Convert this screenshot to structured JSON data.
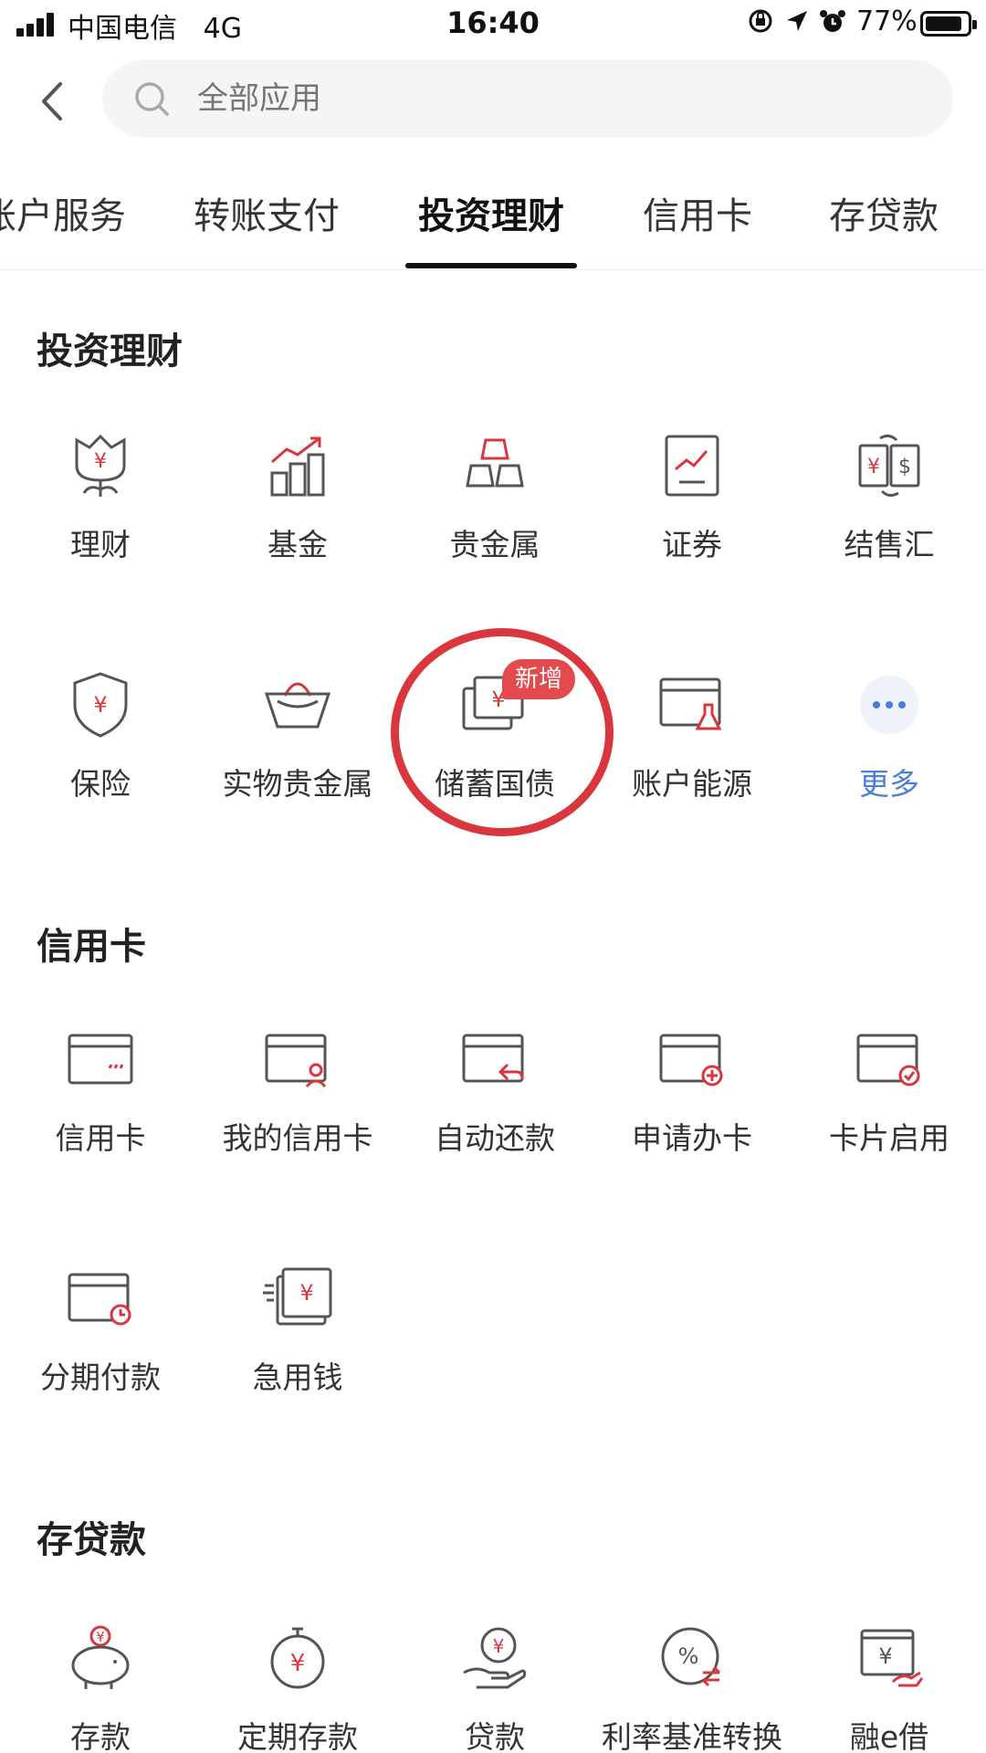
{
  "status_bar": {
    "carrier": "中国电信",
    "network": "4G",
    "time": "16:40",
    "battery": "77%"
  },
  "search": {
    "placeholder": "全部应用"
  },
  "tabs": [
    {
      "label": "账户服务",
      "active": false
    },
    {
      "label": "转账支付",
      "active": false
    },
    {
      "label": "投资理财",
      "active": true
    },
    {
      "label": "信用卡",
      "active": false
    },
    {
      "label": "存贷款",
      "active": false
    }
  ],
  "sections": [
    {
      "title": "投资理财",
      "items": [
        {
          "label": "理财",
          "icon": "flower-yuan-icon"
        },
        {
          "label": "基金",
          "icon": "bar-chart-up-icon"
        },
        {
          "label": "贵金属",
          "icon": "gold-bars-icon"
        },
        {
          "label": "证券",
          "icon": "stock-chart-icon"
        },
        {
          "label": "结售汇",
          "icon": "currency-exchange-icon"
        },
        {
          "label": "保险",
          "icon": "shield-yuan-icon"
        },
        {
          "label": "实物贵金属",
          "icon": "gold-ingot-icon"
        },
        {
          "label": "储蓄国债",
          "icon": "bond-cards-icon",
          "badge": "新增"
        },
        {
          "label": "账户能源",
          "icon": "card-flask-icon"
        },
        {
          "label": "更多",
          "icon": "more-dots-icon"
        }
      ]
    },
    {
      "title": "信用卡",
      "items": [
        {
          "label": "信用卡",
          "icon": "credit-card-icon"
        },
        {
          "label": "我的信用卡",
          "icon": "card-user-icon"
        },
        {
          "label": "自动还款",
          "icon": "card-repay-icon"
        },
        {
          "label": "申请办卡",
          "icon": "card-apply-icon"
        },
        {
          "label": "卡片启用",
          "icon": "card-activate-icon"
        },
        {
          "label": "分期付款",
          "icon": "card-clock-icon"
        },
        {
          "label": "急用钱",
          "icon": "quick-cash-icon"
        }
      ]
    },
    {
      "title": "存贷款",
      "items": [
        {
          "label": "存款",
          "icon": "piggy-bank-icon"
        },
        {
          "label": "定期存款",
          "icon": "timer-yuan-icon"
        },
        {
          "label": "贷款",
          "icon": "hand-coin-icon"
        },
        {
          "label": "利率基准转换",
          "icon": "percent-exchange-icon"
        },
        {
          "label": "融e借",
          "icon": "hand-card-yuan-icon"
        }
      ]
    }
  ],
  "colors": {
    "accent_red": "#d9363e",
    "icon_gray": "#555555",
    "more_blue": "#4a7fd6",
    "badge_red": "#e24a4e"
  }
}
